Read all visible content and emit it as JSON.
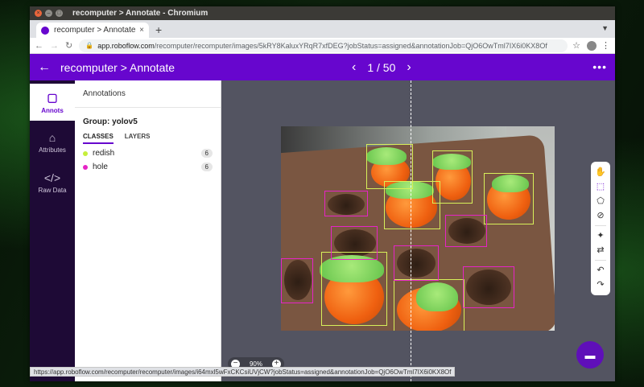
{
  "window": {
    "title": "recomputer > Annotate - Chromium"
  },
  "tab": {
    "label": "recomputer > Annotate",
    "close": "×",
    "new": "+"
  },
  "address": {
    "url_host": "app.roboflow.com",
    "url_path": "/recomputer/recomputer/images/5kRY8KaluxYRqR7xfDEG?jobStatus=assigned&annotationJob=QjO6OwTml7IX6i0KX8Of"
  },
  "appbar": {
    "back": "←",
    "title": "recomputer > Annotate",
    "prev": "‹",
    "next": "›",
    "page": "1 / 50",
    "more": "•••"
  },
  "rail": [
    {
      "label": "Annots",
      "icon": "annotations-icon"
    },
    {
      "label": "Attributes",
      "icon": "tag-icon"
    },
    {
      "label": "Raw Data",
      "icon": "code-icon"
    }
  ],
  "panel": {
    "header": "Annotations",
    "group": "Group: yolov5",
    "tabs": [
      "CLASSES",
      "LAYERS"
    ],
    "classes": [
      {
        "name": "redish",
        "count": "6",
        "color": "#c6ef3a"
      },
      {
        "name": "hole",
        "count": "6",
        "color": "#e624c6"
      }
    ]
  },
  "zoom": {
    "value": "90%",
    "minus": "−",
    "plus": "+"
  },
  "status_url": "https://app.roboflow.com/recomputer/recomputer/images/i64mxl5wFxCKCsiUVjCW?jobStatus=assigned&annotationJob=QjO6OwTml7IX6i0KX8Of"
}
